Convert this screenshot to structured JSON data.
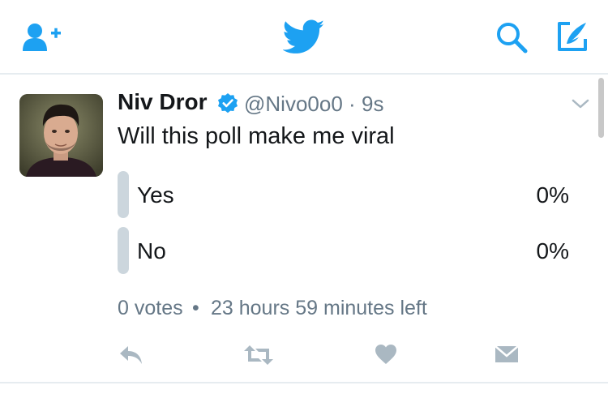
{
  "header": {
    "icons": [
      "add-user-icon",
      "twitter-bird-icon",
      "search-icon",
      "compose-tweet-icon"
    ],
    "accent_color": "#1da1f2"
  },
  "tweet": {
    "author_name": "Niv Dror",
    "verified": true,
    "handle": "@Nivo0o0",
    "separator": "·",
    "timestamp": "9s",
    "text": "Will this poll make me viral",
    "poll": {
      "options": [
        {
          "label": "Yes",
          "percent": "0%"
        },
        {
          "label": "No",
          "percent": "0%"
        }
      ],
      "votes": "0 votes",
      "bullet": "•",
      "time_left": "23 hours 59 minutes left"
    },
    "actions": [
      "reply-icon",
      "retweet-icon",
      "like-icon",
      "direct-message-icon"
    ]
  },
  "colors": {
    "text_primary": "#14171a",
    "text_secondary": "#657786",
    "icon_gray": "#aab8c2",
    "poll_bar": "#ccd6dd",
    "divider": "#e6ecf0"
  }
}
